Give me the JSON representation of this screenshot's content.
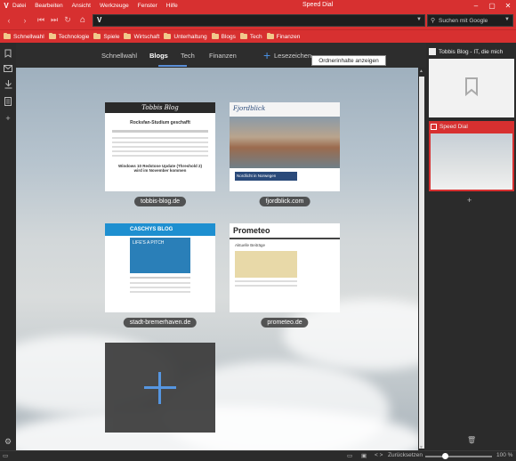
{
  "menu": {
    "logo": "V",
    "items": [
      "Datei",
      "Bearbeiten",
      "Ansicht",
      "Werkzeuge",
      "Fenster",
      "Hilfe"
    ],
    "window_title": "Speed Dial",
    "controls": [
      "–",
      "▢",
      "✕"
    ]
  },
  "nav": {
    "back": "‹",
    "forward": "›",
    "rewind": "⏮",
    "fastforward": "⏭",
    "reload": "↻",
    "home": "⌂",
    "url_logo": "V",
    "url_value": "",
    "search_placeholder": "Suchen mit Google"
  },
  "bookmarks": [
    "Schnellwahl",
    "Technologie",
    "Spiele",
    "Wirtschaft",
    "Unterhaltung",
    "Blogs",
    "Tech",
    "Finanzen"
  ],
  "speed_dial": {
    "tabs": [
      "Schnellwahl",
      "Blogs",
      "Tech",
      "Finanzen",
      "Lesezeichen"
    ],
    "active_tab": "Blogs",
    "add_symbol": "+",
    "tooltip": "Ordnerinhalte anzeigen",
    "dials": [
      {
        "label": "tobbis-blog.de",
        "heading": "Tobbis Blog",
        "subtitle": "Rocksfan-Studium geschafft",
        "story": "Windows 10 Redstone Update (Threshold 2) wird im November kommen"
      },
      {
        "label": "fjordblick.com",
        "heading": "Fjordblick",
        "caption": "Nordlicht in Norwegen"
      },
      {
        "label": "stadt-bremerhaven.de",
        "heading": "CASCHYS BLOG",
        "banner": "LIFE'S A PITCH"
      },
      {
        "label": "prometeo.de",
        "heading": "Prometeo",
        "subtitle": "Aktuelle Beiträge"
      }
    ]
  },
  "right_panel": {
    "tabs": [
      {
        "title": "Tobbis Blog - IT, die mich"
      },
      {
        "title": "Speed Dial"
      }
    ],
    "add_symbol": "+",
    "trash_symbol": "🗑"
  },
  "status": {
    "reset_label": "Zurücksetzen",
    "zoom_level": "100 %",
    "zoom_fraction": 0.3,
    "code_symbol": "< >"
  },
  "colors": {
    "accent": "#d73030",
    "highlight": "#4a8fe0"
  }
}
